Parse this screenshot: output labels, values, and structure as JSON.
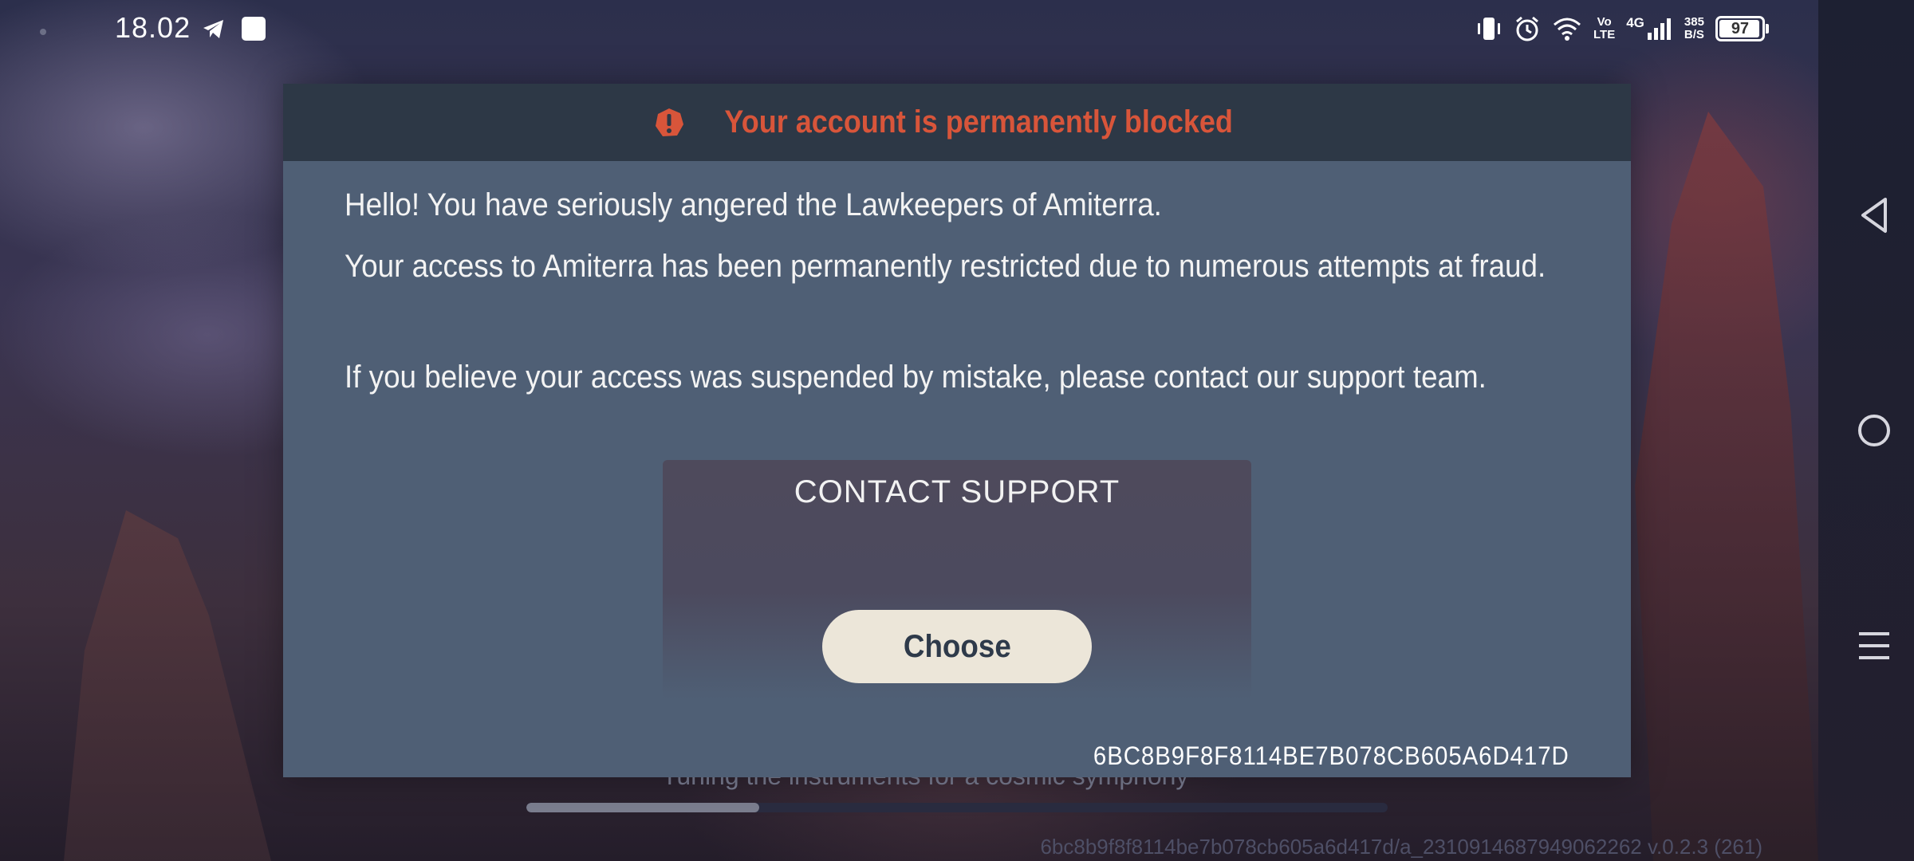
{
  "status_bar": {
    "time": "18.02",
    "icons": [
      "telegram-icon",
      "app-square-icon",
      "vibrate-icon",
      "alarm-icon",
      "wifi-icon",
      "volte-icon",
      "signal-4g-icon"
    ],
    "volte_top": "Vo",
    "volte_bottom": "LTE",
    "network_type": "4G",
    "speed_value": "385",
    "speed_unit": "B/S",
    "battery": "97",
    "battery_level": 0.97
  },
  "dialog": {
    "title": "Your account is permanently blocked",
    "title_color": "#d8553a",
    "paragraph1": "Hello! You have seriously angered the Lawkeepers of Amiterra.",
    "paragraph2": "Your access to Amiterra has been permanently restricted due to numerous attempts at fraud.",
    "paragraph3": "If you believe your access was suspended by mistake, please contact our support team.",
    "support_title": "CONTACT SUPPORT",
    "choose_label": "Choose",
    "device_id": "6BC8B9F8F8114BE7B078CB605A6D417D"
  },
  "background": {
    "loading_text": "Tuning the instruments for a cosmic symphony",
    "loading_progress": 0.27,
    "build_info": "6bc8b9f8f8114be7b078cb605a6d417d/a_2310914687949062262  v.0.2.3 (261)"
  },
  "nav": {
    "back": "back-icon",
    "home": "home-icon",
    "menu": "menu-icon"
  }
}
